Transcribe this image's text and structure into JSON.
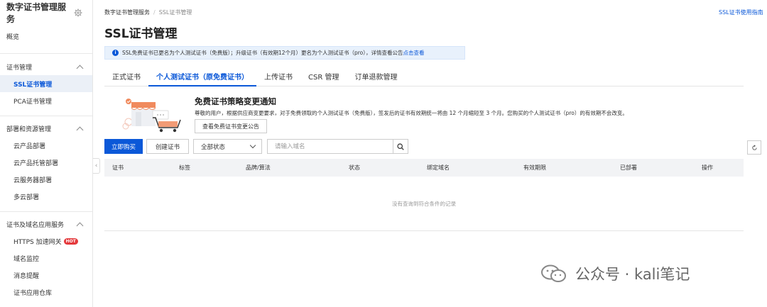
{
  "sidebar": {
    "title": "数字证书管理服务",
    "overview": "概览",
    "groups": [
      {
        "label": "证书管理",
        "items": [
          "SSL证书管理",
          "PCA证书管理"
        ]
      },
      {
        "label": "部署和资源管理",
        "items": [
          "云产品部署",
          "云产品托管部署",
          "云服务器部署",
          "多云部署"
        ]
      },
      {
        "label": "证书及域名应用服务",
        "items": [
          "HTTPS 加速网关",
          "域名监控",
          "消息提醒",
          "证书应用仓库"
        ]
      }
    ],
    "hot_badge": "HOT"
  },
  "breadcrumb": {
    "root": "数字证书管理服务",
    "separator": "/",
    "current": "SSL证书管理"
  },
  "guide_link": "SSL证书使用指南",
  "page_title": "SSL证书管理",
  "notice": {
    "text": "SSL免费证书已更名为个人测试证书（免费版）；升级证书（有效期12个月）更名为个人测试证书（pro），详情查看公告",
    "link": "点击查看"
  },
  "tabs": [
    "正式证书",
    "个人测试证书（原免费证书）",
    "上传证书",
    "CSR 管理",
    "订单退款管理"
  ],
  "banner": {
    "title": "免费证书策略变更通知",
    "desc": "尊敬的用户，根据供应商变更要求，对于免费领取的个人测试证书（免费版），签发后的证书有效期统一将由 12 个月缩短至 3 个月。您购买的个人测试证书（pro）的有效期不会改变。",
    "button": "查看免费证书变更公告"
  },
  "toolbar": {
    "buy": "立即购买",
    "create": "创建证书",
    "status_select": "全部状态",
    "search_placeholder": "请输入域名"
  },
  "table": {
    "columns": [
      "证书",
      "标签",
      "品牌/算法",
      "状态",
      "绑定域名",
      "有效期限",
      "已部署",
      "操作"
    ],
    "empty": "没有查询到符合条件的记录"
  },
  "watermark": "公众号 · kali笔记",
  "colors": {
    "primary": "#0b58d8",
    "notice_bg": "#e8f1fc",
    "hot": "#e4393c"
  }
}
